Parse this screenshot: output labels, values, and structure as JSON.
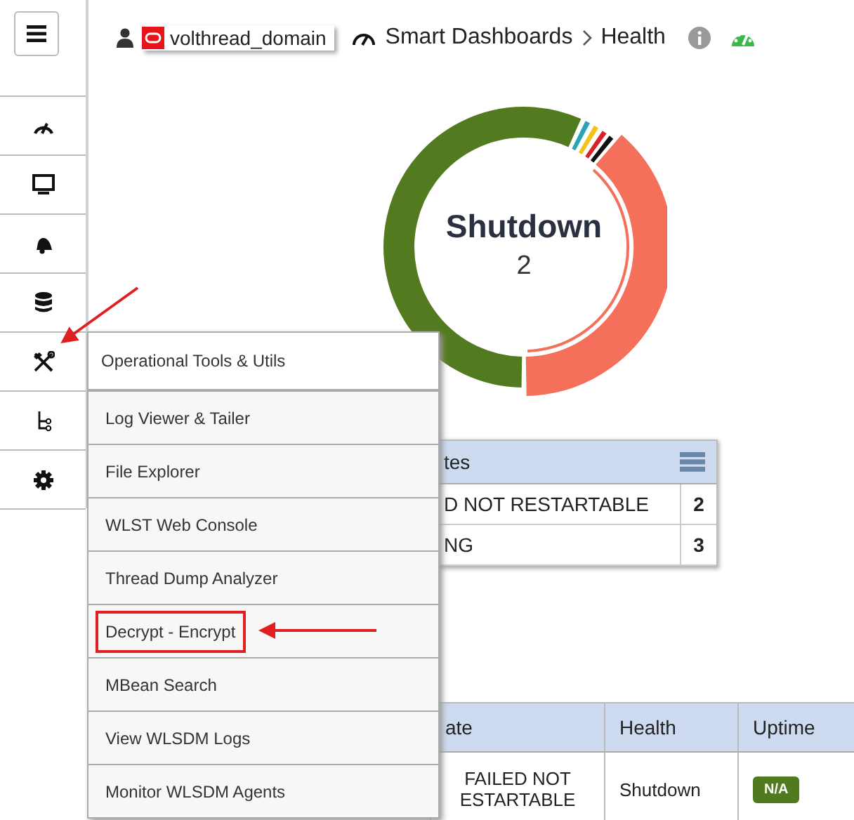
{
  "header": {
    "domain": "volthread_domain",
    "breadcrumb": [
      "Smart Dashboards",
      "Health"
    ]
  },
  "donut": {
    "label": "Shutdown",
    "count": "2"
  },
  "menu": {
    "title": "Operational Tools & Utils",
    "items": [
      {
        "label": "Log Viewer & Tailer",
        "highlighted": false
      },
      {
        "label": "File Explorer",
        "highlighted": false
      },
      {
        "label": "WLST Web Console",
        "highlighted": false
      },
      {
        "label": "Thread Dump Analyzer",
        "highlighted": false
      },
      {
        "label": "Decrypt - Encrypt",
        "highlighted": true
      },
      {
        "label": "MBean Search",
        "highlighted": false
      },
      {
        "label": "View WLSDM Logs",
        "highlighted": false
      },
      {
        "label": "Monitor WLSDM Agents",
        "highlighted": false
      }
    ]
  },
  "states_table": {
    "header": "tes",
    "rows": [
      {
        "name": "D NOT RESTARTABLE",
        "count": "2"
      },
      {
        "name": "NG",
        "count": "3"
      }
    ]
  },
  "servers_table": {
    "columns": [
      "ate",
      "Health",
      "Uptime"
    ],
    "rows": [
      {
        "state": "FAILED NOT ESTARTABLE",
        "health": "Shutdown",
        "uptime": "N/A"
      }
    ]
  }
}
